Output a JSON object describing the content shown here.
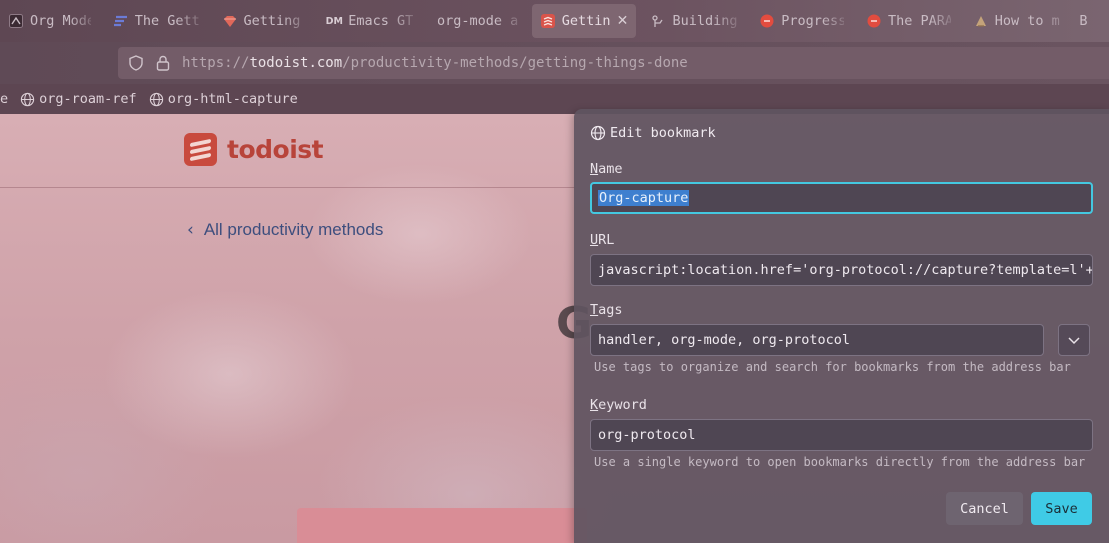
{
  "tabs": [
    {
      "label": "Org Mode",
      "icon": "org-mode-icon",
      "active": false
    },
    {
      "label": "The Gett",
      "icon": "fortelabs-icon",
      "active": false
    },
    {
      "label": "Getting",
      "icon": "ruby-icon",
      "active": false
    },
    {
      "label": "Emacs GT",
      "icon": "dm-icon",
      "icon_text": "DM",
      "active": false
    },
    {
      "label": "org-mode an",
      "icon": "",
      "active": false
    },
    {
      "label": "Gettin",
      "icon": "todoist-icon",
      "active": true
    },
    {
      "label": "Building",
      "icon": "building-icon",
      "active": false
    },
    {
      "label": "Progress",
      "icon": "red-circle-icon",
      "active": false
    },
    {
      "label": "The PARA",
      "icon": "red-circle-icon",
      "active": false
    },
    {
      "label": "How to m",
      "icon": "book-icon",
      "active": false
    },
    {
      "label": "B",
      "icon": "",
      "active": false
    }
  ],
  "address_bar": {
    "url_prefix": "https://",
    "url_domain": "todoist.com",
    "url_path": "/productivity-methods/getting-things-done"
  },
  "bookmarks_toolbar": [
    {
      "label": "e",
      "icon": ""
    },
    {
      "label": "org-roam-ref",
      "icon": "globe-icon"
    },
    {
      "label": "org-html-capture",
      "icon": "globe-icon"
    }
  ],
  "page": {
    "logo_text": "todoist",
    "back_link": "All productivity methods",
    "heading_fragment": "G"
  },
  "edit_bookmark": {
    "title": "Edit bookmark",
    "name_label_key": "N",
    "name_label_rest": "ame",
    "name_value": "Org-capture",
    "url_label_key": "U",
    "url_label_rest": "RL",
    "url_value": "javascript:location.href='org-protocol://capture?template=l'+",
    "tags_label_key": "T",
    "tags_label_rest": "ags",
    "tags_value": "handler, org-mode, org-protocol",
    "tags_hint": "Use tags to organize and search for bookmarks from the address bar",
    "keyword_label_key": "K",
    "keyword_label_rest": "eyword",
    "keyword_value": "org-protocol",
    "keyword_hint": "Use a single keyword to open bookmarks directly from the address bar",
    "cancel_label": "Cancel",
    "save_label": "Save"
  },
  "colors": {
    "accent": "#3fcbe6",
    "todoist_red": "#c84a3e",
    "selection": "#3e7fcf"
  }
}
